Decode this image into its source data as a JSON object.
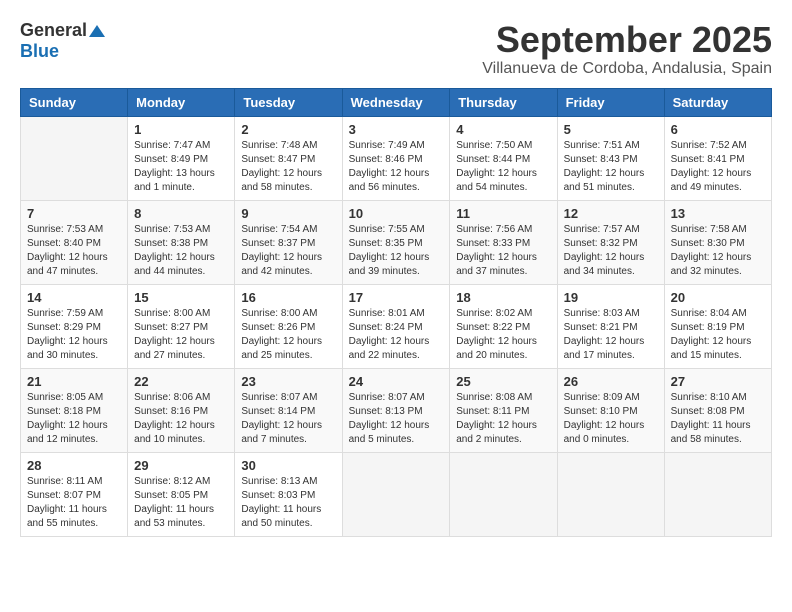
{
  "header": {
    "logo_general": "General",
    "logo_blue": "Blue",
    "month_title": "September 2025",
    "location": "Villanueva de Cordoba, Andalusia, Spain"
  },
  "weekdays": [
    "Sunday",
    "Monday",
    "Tuesday",
    "Wednesday",
    "Thursday",
    "Friday",
    "Saturday"
  ],
  "weeks": [
    [
      {
        "day": "",
        "info": ""
      },
      {
        "day": "1",
        "info": "Sunrise: 7:47 AM\nSunset: 8:49 PM\nDaylight: 13 hours\nand 1 minute."
      },
      {
        "day": "2",
        "info": "Sunrise: 7:48 AM\nSunset: 8:47 PM\nDaylight: 12 hours\nand 58 minutes."
      },
      {
        "day": "3",
        "info": "Sunrise: 7:49 AM\nSunset: 8:46 PM\nDaylight: 12 hours\nand 56 minutes."
      },
      {
        "day": "4",
        "info": "Sunrise: 7:50 AM\nSunset: 8:44 PM\nDaylight: 12 hours\nand 54 minutes."
      },
      {
        "day": "5",
        "info": "Sunrise: 7:51 AM\nSunset: 8:43 PM\nDaylight: 12 hours\nand 51 minutes."
      },
      {
        "day": "6",
        "info": "Sunrise: 7:52 AM\nSunset: 8:41 PM\nDaylight: 12 hours\nand 49 minutes."
      }
    ],
    [
      {
        "day": "7",
        "info": "Sunrise: 7:53 AM\nSunset: 8:40 PM\nDaylight: 12 hours\nand 47 minutes."
      },
      {
        "day": "8",
        "info": "Sunrise: 7:53 AM\nSunset: 8:38 PM\nDaylight: 12 hours\nand 44 minutes."
      },
      {
        "day": "9",
        "info": "Sunrise: 7:54 AM\nSunset: 8:37 PM\nDaylight: 12 hours\nand 42 minutes."
      },
      {
        "day": "10",
        "info": "Sunrise: 7:55 AM\nSunset: 8:35 PM\nDaylight: 12 hours\nand 39 minutes."
      },
      {
        "day": "11",
        "info": "Sunrise: 7:56 AM\nSunset: 8:33 PM\nDaylight: 12 hours\nand 37 minutes."
      },
      {
        "day": "12",
        "info": "Sunrise: 7:57 AM\nSunset: 8:32 PM\nDaylight: 12 hours\nand 34 minutes."
      },
      {
        "day": "13",
        "info": "Sunrise: 7:58 AM\nSunset: 8:30 PM\nDaylight: 12 hours\nand 32 minutes."
      }
    ],
    [
      {
        "day": "14",
        "info": "Sunrise: 7:59 AM\nSunset: 8:29 PM\nDaylight: 12 hours\nand 30 minutes."
      },
      {
        "day": "15",
        "info": "Sunrise: 8:00 AM\nSunset: 8:27 PM\nDaylight: 12 hours\nand 27 minutes."
      },
      {
        "day": "16",
        "info": "Sunrise: 8:00 AM\nSunset: 8:26 PM\nDaylight: 12 hours\nand 25 minutes."
      },
      {
        "day": "17",
        "info": "Sunrise: 8:01 AM\nSunset: 8:24 PM\nDaylight: 12 hours\nand 22 minutes."
      },
      {
        "day": "18",
        "info": "Sunrise: 8:02 AM\nSunset: 8:22 PM\nDaylight: 12 hours\nand 20 minutes."
      },
      {
        "day": "19",
        "info": "Sunrise: 8:03 AM\nSunset: 8:21 PM\nDaylight: 12 hours\nand 17 minutes."
      },
      {
        "day": "20",
        "info": "Sunrise: 8:04 AM\nSunset: 8:19 PM\nDaylight: 12 hours\nand 15 minutes."
      }
    ],
    [
      {
        "day": "21",
        "info": "Sunrise: 8:05 AM\nSunset: 8:18 PM\nDaylight: 12 hours\nand 12 minutes."
      },
      {
        "day": "22",
        "info": "Sunrise: 8:06 AM\nSunset: 8:16 PM\nDaylight: 12 hours\nand 10 minutes."
      },
      {
        "day": "23",
        "info": "Sunrise: 8:07 AM\nSunset: 8:14 PM\nDaylight: 12 hours\nand 7 minutes."
      },
      {
        "day": "24",
        "info": "Sunrise: 8:07 AM\nSunset: 8:13 PM\nDaylight: 12 hours\nand 5 minutes."
      },
      {
        "day": "25",
        "info": "Sunrise: 8:08 AM\nSunset: 8:11 PM\nDaylight: 12 hours\nand 2 minutes."
      },
      {
        "day": "26",
        "info": "Sunrise: 8:09 AM\nSunset: 8:10 PM\nDaylight: 12 hours\nand 0 minutes."
      },
      {
        "day": "27",
        "info": "Sunrise: 8:10 AM\nSunset: 8:08 PM\nDaylight: 11 hours\nand 58 minutes."
      }
    ],
    [
      {
        "day": "28",
        "info": "Sunrise: 8:11 AM\nSunset: 8:07 PM\nDaylight: 11 hours\nand 55 minutes."
      },
      {
        "day": "29",
        "info": "Sunrise: 8:12 AM\nSunset: 8:05 PM\nDaylight: 11 hours\nand 53 minutes."
      },
      {
        "day": "30",
        "info": "Sunrise: 8:13 AM\nSunset: 8:03 PM\nDaylight: 11 hours\nand 50 minutes."
      },
      {
        "day": "",
        "info": ""
      },
      {
        "day": "",
        "info": ""
      },
      {
        "day": "",
        "info": ""
      },
      {
        "day": "",
        "info": ""
      }
    ]
  ]
}
